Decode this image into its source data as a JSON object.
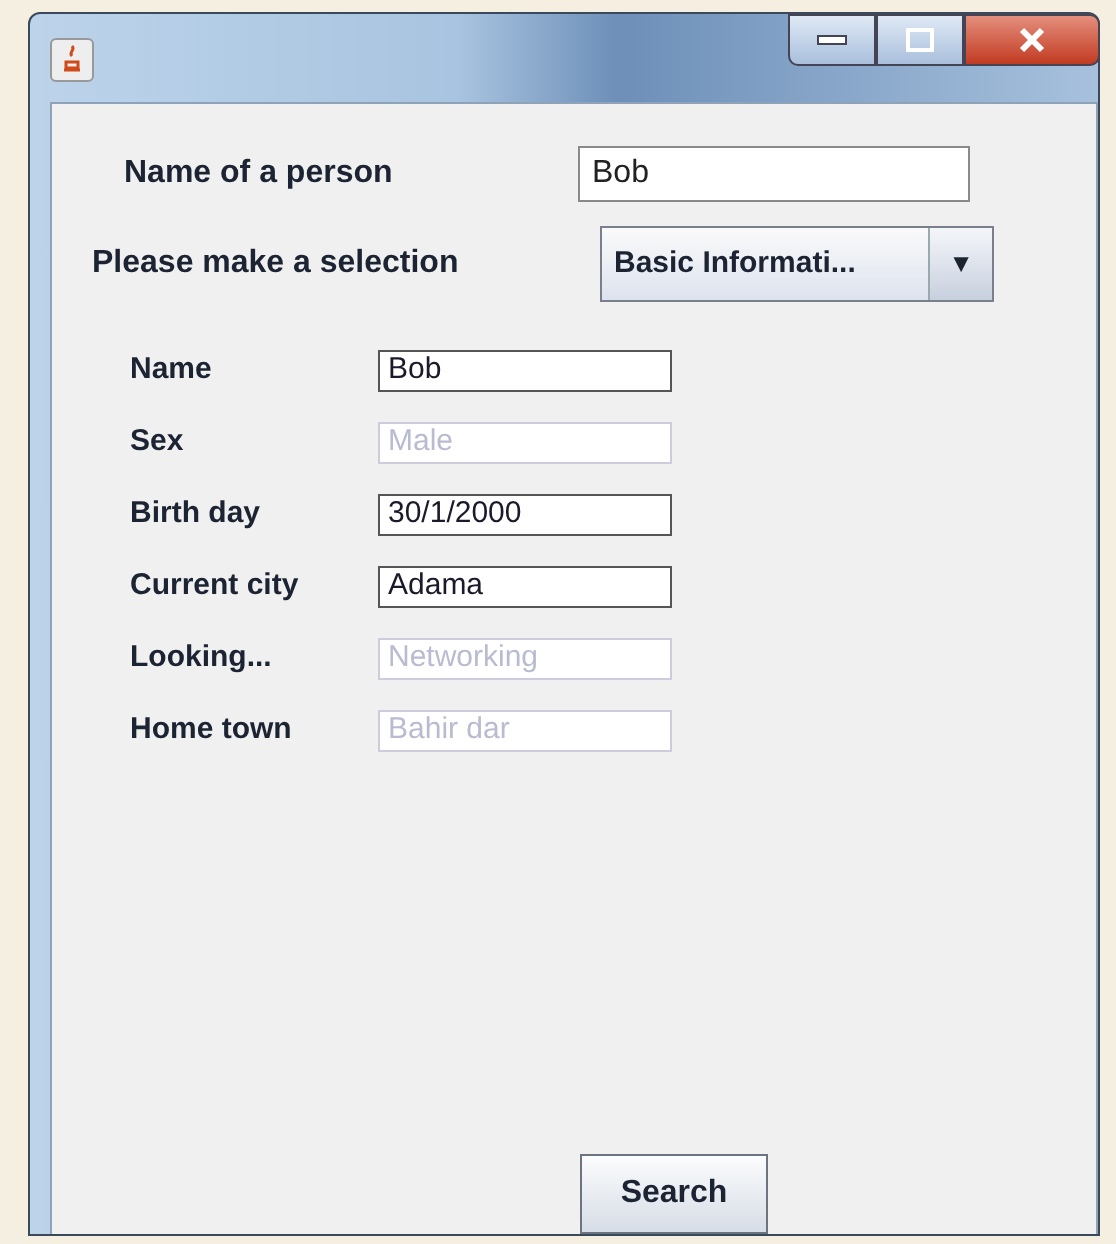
{
  "person_name": {
    "label": "Name of a person",
    "value": "Bob"
  },
  "selection": {
    "label": "Please make a selection",
    "value": "Basic Informati...",
    "arrow": "▼"
  },
  "fields": [
    {
      "label": "Name",
      "value": "Bob",
      "disabled": false
    },
    {
      "label": "Sex",
      "value": "Male",
      "disabled": true
    },
    {
      "label": "Birth day",
      "value": "30/1/2000",
      "disabled": false
    },
    {
      "label": "Current city",
      "value": "Adama",
      "disabled": false
    },
    {
      "label": "Looking...",
      "value": "Networking",
      "disabled": true
    },
    {
      "label": "Home town",
      "value": "Bahir dar",
      "disabled": true
    }
  ],
  "buttons": [
    "Search"
  ]
}
